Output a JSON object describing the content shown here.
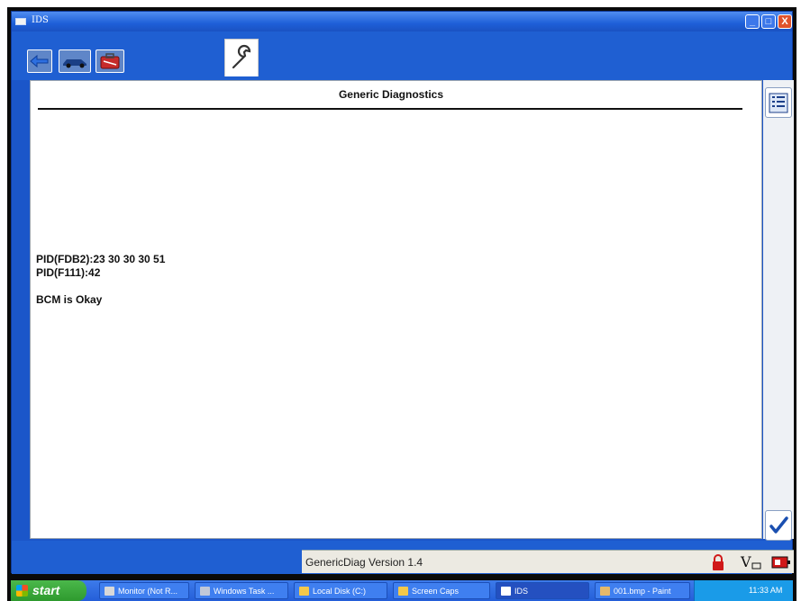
{
  "window": {
    "title": "IDS",
    "min": "_",
    "max": "□",
    "close": "X"
  },
  "toolbar": {
    "icons": [
      "connect-icon",
      "vehicle-icon",
      "toolbox-icon",
      "wrench-icon"
    ]
  },
  "content": {
    "title": "Generic Diagnostics",
    "lines": [
      "PID(FDB2):23 30 30 30 51",
      "PID(F111):42",
      "BCM is Okay"
    ]
  },
  "side": {
    "icons": [
      "list-icon",
      "checkmark-icon"
    ]
  },
  "status": {
    "version_text": "GenericDiag Version 1.4",
    "icons": [
      "lock-icon",
      "voltage-icon",
      "battery-icon"
    ]
  },
  "taskbar": {
    "start_label": "start",
    "tasks": [
      {
        "label": "Monitor (Not R...",
        "color": "#d8d8d8"
      },
      {
        "label": "Windows Task ...",
        "color": "#c0c8d8"
      },
      {
        "label": "Local Disk (C:)",
        "color": "#f3c84a"
      },
      {
        "label": "Screen Caps",
        "color": "#f3c84a"
      },
      {
        "label": "IDS",
        "color": "#ffffff"
      },
      {
        "label": "001.bmp - Paint",
        "color": "#e5b96a"
      }
    ],
    "clock": "11:33 AM"
  },
  "colors": {
    "accent_blue": "#1f5fd2",
    "content_bg": "#ffffff",
    "lock_red": "#d01818"
  }
}
